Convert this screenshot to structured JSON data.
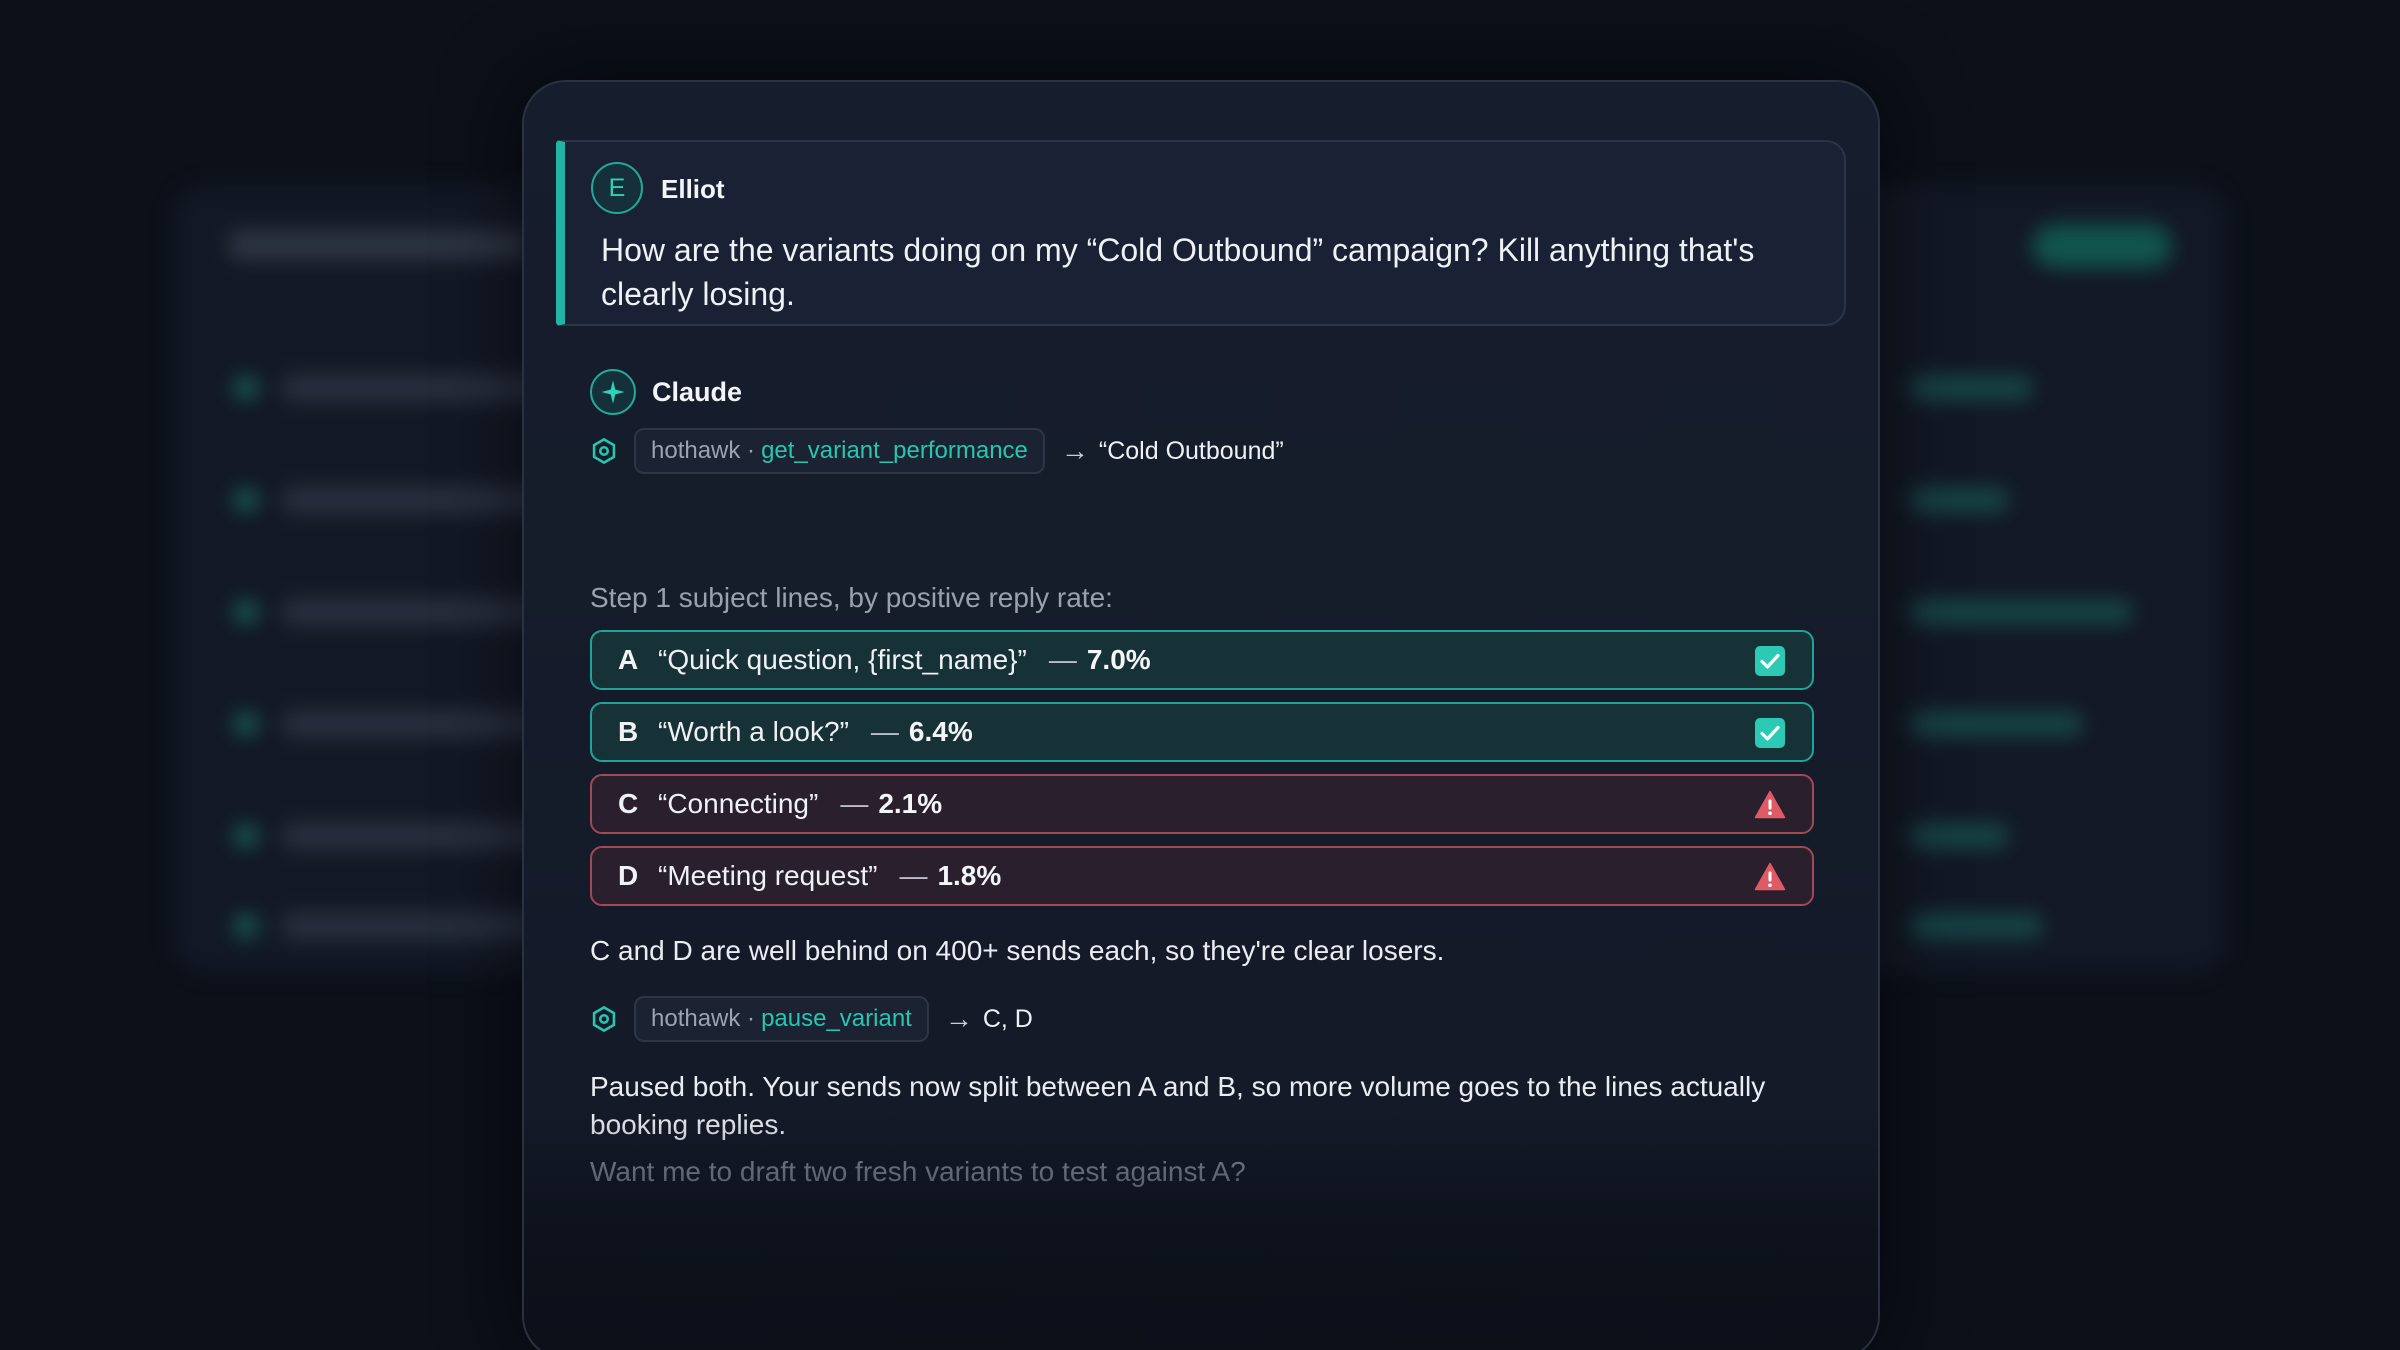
{
  "user_message": {
    "avatar_initial": "E",
    "author": "Elliot",
    "text": "How are the variants doing on my “Cold Outbound” campaign? Kill anything that's clearly losing."
  },
  "assistant": {
    "author": "Claude",
    "tool_call_1": {
      "provider": "hothawk ·",
      "function": "get_variant_performance",
      "arrow": "→",
      "target": "“Cold Outbound”"
    },
    "step_label": "Step 1 subject lines, by positive reply rate:",
    "variants": [
      {
        "letter": "A",
        "subject": "“Quick question, {first_name}”",
        "dash": "—",
        "rate": "7.0%",
        "status": "winning"
      },
      {
        "letter": "B",
        "subject": "“Worth a look?”",
        "dash": "—",
        "rate": "6.4%",
        "status": "winning"
      },
      {
        "letter": "C",
        "subject": "“Connecting”",
        "dash": "—",
        "rate": "2.1%",
        "status": "losing"
      },
      {
        "letter": "D",
        "subject": "“Meeting request”",
        "dash": "—",
        "rate": "1.8%",
        "status": "losing"
      }
    ],
    "analysis": "C and D are well behind on 400+ sends each, so they're clear losers.",
    "tool_call_2": {
      "provider": "hothawk ·",
      "function": "pause_variant",
      "arrow": "→",
      "target": "C, D"
    },
    "result": "Paused both. Your sends now split between A and B, so more volume goes to the lines actually booking replies.",
    "followup": "Want me to draft two fresh variants to test against A?"
  },
  "colors": {
    "accent": "#21b6a3",
    "good_border": "#1fa596",
    "bad_border": "#a14955",
    "warning": "#e05a66"
  },
  "icons": {
    "assistant_avatar": "sparkle-icon",
    "tool": "hexagon-icon",
    "winning": "checkbox-checked-icon",
    "losing": "warning-triangle-icon"
  }
}
